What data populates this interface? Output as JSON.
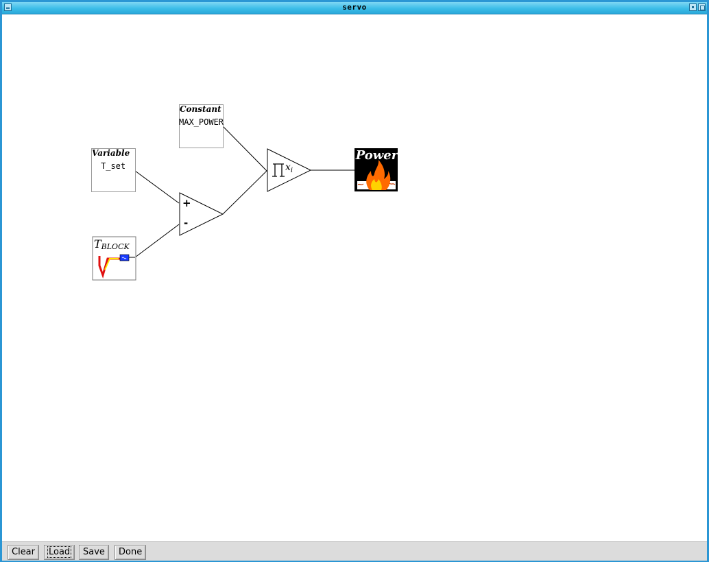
{
  "window": {
    "title": "servo"
  },
  "blocks": {
    "constant": {
      "kind": "Constant",
      "value": "MAX_POWER"
    },
    "variable": {
      "kind": "Variable",
      "value": "T_set"
    },
    "sum": {
      "plus": "+",
      "minus": "-"
    },
    "product": {
      "label": "∏xᵢ"
    },
    "tblock": {
      "label": "T",
      "subscript": "BLOCK"
    },
    "power": {
      "label": "Power"
    }
  },
  "buttons": {
    "clear": "Clear",
    "load": "Load",
    "save": "Save",
    "done": "Done"
  },
  "colors": {
    "titlebar": "#3cbde8",
    "frame": "#2b96d4",
    "buttonbar": "#dcdcdc",
    "flame": "#ff8a00"
  }
}
